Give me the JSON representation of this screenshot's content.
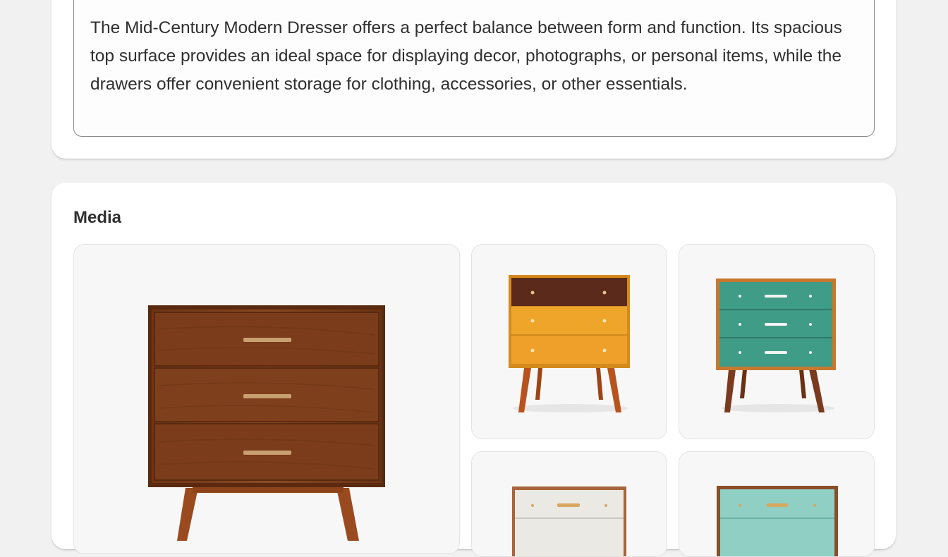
{
  "product": {
    "description": "The Mid-Century Modern Dresser offers a perfect balance between form and function. Its spacious top surface provides an ideal space for displaying decor, photographs, or personal items, while the drawers offer convenient storage for clothing, accessories, or other essentials."
  },
  "media": {
    "title": "Media",
    "items": [
      {
        "name": "walnut-three-drawer-dresser",
        "color": "#7a3d1c"
      },
      {
        "name": "yellow-two-tone-dresser",
        "color": "#e89a1f"
      },
      {
        "name": "teal-dresser",
        "color": "#3f9c86"
      },
      {
        "name": "white-dresser",
        "color": "#e9e7e2"
      },
      {
        "name": "mint-dresser",
        "color": "#8fcfc4"
      }
    ]
  }
}
